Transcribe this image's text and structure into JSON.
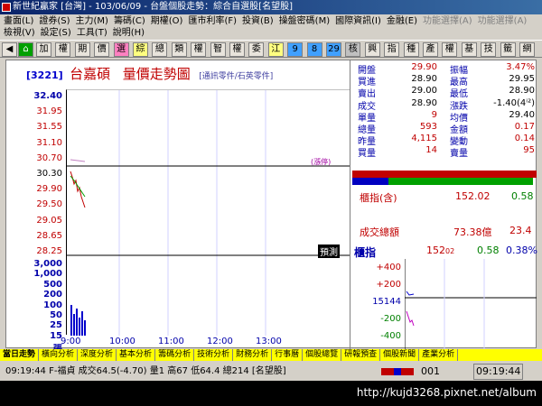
{
  "window": {
    "title": "新世紀贏家 [台灣] - 103/06/09 - 台盤個股走勢：綜合自選股[名望股]"
  },
  "menu": {
    "row1": [
      "畫面(L)",
      "證券(S)",
      "主力(M)",
      "籌碼(C)",
      "期權(O)",
      "匯市利率(F)",
      "投資(B)",
      "操盤密碼(M)",
      "國際資訊(I)",
      "金融(E)",
      "功能選擇(A)",
      "功能選擇(A)"
    ],
    "row2": [
      "檢視(V)",
      "設定(S)",
      "工具(T)",
      "說明(H)"
    ]
  },
  "toolbar": [
    "加",
    "權",
    "期",
    "價",
    "選",
    "綜",
    "總",
    "類",
    "權",
    "智",
    "權",
    "委",
    "江",
    "9",
    "8",
    "29",
    "核",
    "興",
    "指",
    "種",
    "產",
    "權",
    "基",
    "技",
    "籤",
    "網"
  ],
  "header": {
    "id": "[3221]",
    "name": "台嘉碩",
    "chart_title": "量價走勢圖",
    "industry": "[通訊零件/石英零件]"
  },
  "chart": {
    "price_ticks": [
      "32.40",
      "31.95",
      "31.55",
      "31.10",
      "30.70",
      "30.30",
      "29.90",
      "29.50",
      "29.05",
      "28.65",
      "28.25"
    ],
    "volume_ticks": [
      "3,000",
      "1,000",
      "500",
      "200",
      "100",
      "50",
      "25",
      "15",
      "張"
    ],
    "time_ticks": [
      "9:00",
      "10:00",
      "11:00",
      "12:00",
      "13:00"
    ],
    "limit_label": "(漲停)",
    "button": "預測"
  },
  "quote": {
    "open_label": "開盤",
    "open": "29.90",
    "amp_label": "振幅",
    "amp": "3.47%",
    "bid_label": "買進",
    "bid": "28.90",
    "high_label": "最高",
    "high": "29.95",
    "ask_label": "賣出",
    "ask": "29.00",
    "low_label": "最低",
    "low": "28.90",
    "deal_label": "成交",
    "deal": "28.90",
    "chg_label": "漲跌",
    "chg": "-1.40(4ⁱ²)",
    "single_label": "單量",
    "single": "9",
    "avg_label": "均價",
    "avg": "29.40",
    "total_label": "總量",
    "total": "593",
    "amount_label": "金額",
    "amount": "0.17",
    "yest_label": "昨量",
    "yest": "4,115",
    "turnover_label": "變動",
    "turnover": "0.14",
    "buyvol_label": "買量",
    "buyvol": "14",
    "sellvol_label": "賣量",
    "sellvol": "95"
  },
  "index": {
    "cab_label": "櫃指(含)",
    "cab_value": "152.02",
    "cab_chg": "0.58",
    "turnover_label": "成交總額",
    "turnover_value": "73.38億",
    "turnover_chg": "23.4",
    "title": "櫃指",
    "val": "152",
    "val_small": "02",
    "chg": "0.58",
    "pct": "0.38%",
    "ticks": [
      "+400",
      "+200",
      "15144",
      "-200",
      "-400"
    ]
  },
  "status_tabs": [
    "當日走勢",
    "橫向分析",
    "深度分析",
    "基本分析",
    "籌碼分析",
    "技術分析",
    "財務分析",
    "行事曆",
    "個股總覽",
    "研報預查",
    "個股新聞",
    "產業分析"
  ],
  "ticker": {
    "text": "09:19:44 F-福貞 成交64.5(-4.70) 量1 高67 低64.4 總214 [名望股]",
    "count": "001",
    "time": "09:19:44"
  },
  "watermark": "http://kujd3268.pixnet.net/album"
}
